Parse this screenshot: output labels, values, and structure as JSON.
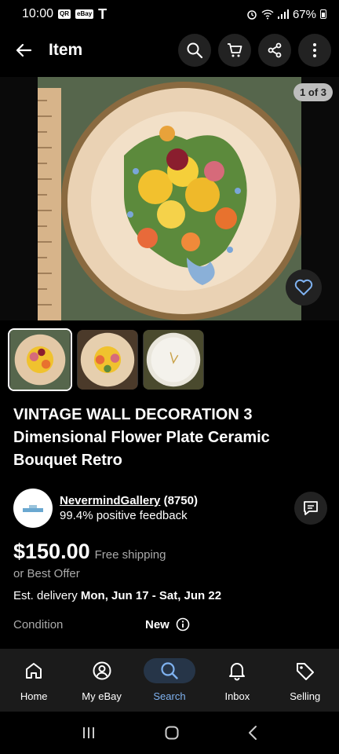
{
  "status_bar": {
    "time": "10:00",
    "badge1": "QR",
    "badge2": "eBay",
    "carrier": "T",
    "battery": "67%"
  },
  "app_bar": {
    "title": "Item"
  },
  "gallery": {
    "counter": "1 of 3"
  },
  "item": {
    "title": "VINTAGE WALL DECORATION 3 Dimensional Flower Plate Ceramic Bouquet Retro",
    "price": "$150.00",
    "shipping": "Free shipping",
    "best_offer": "or Best Offer",
    "delivery_label": "Est. delivery ",
    "delivery_dates": "Mon, Jun 17 - Sat, Jun 22",
    "condition_label": "Condition",
    "condition_value": "New"
  },
  "seller": {
    "name": "NevermindGallery",
    "count": "(8750)",
    "feedback": "99.4% positive feedback"
  },
  "bottom_nav": [
    {
      "label": "Home",
      "icon": "home-icon"
    },
    {
      "label": "My eBay",
      "icon": "user-icon"
    },
    {
      "label": "Search",
      "icon": "search-icon"
    },
    {
      "label": "Inbox",
      "icon": "bell-icon"
    },
    {
      "label": "Selling",
      "icon": "tag-icon"
    }
  ],
  "colors": {
    "accent": "#7fb2f0",
    "background": "#000000",
    "nav_bg": "#1b1b1b",
    "button_bg": "#222222"
  }
}
